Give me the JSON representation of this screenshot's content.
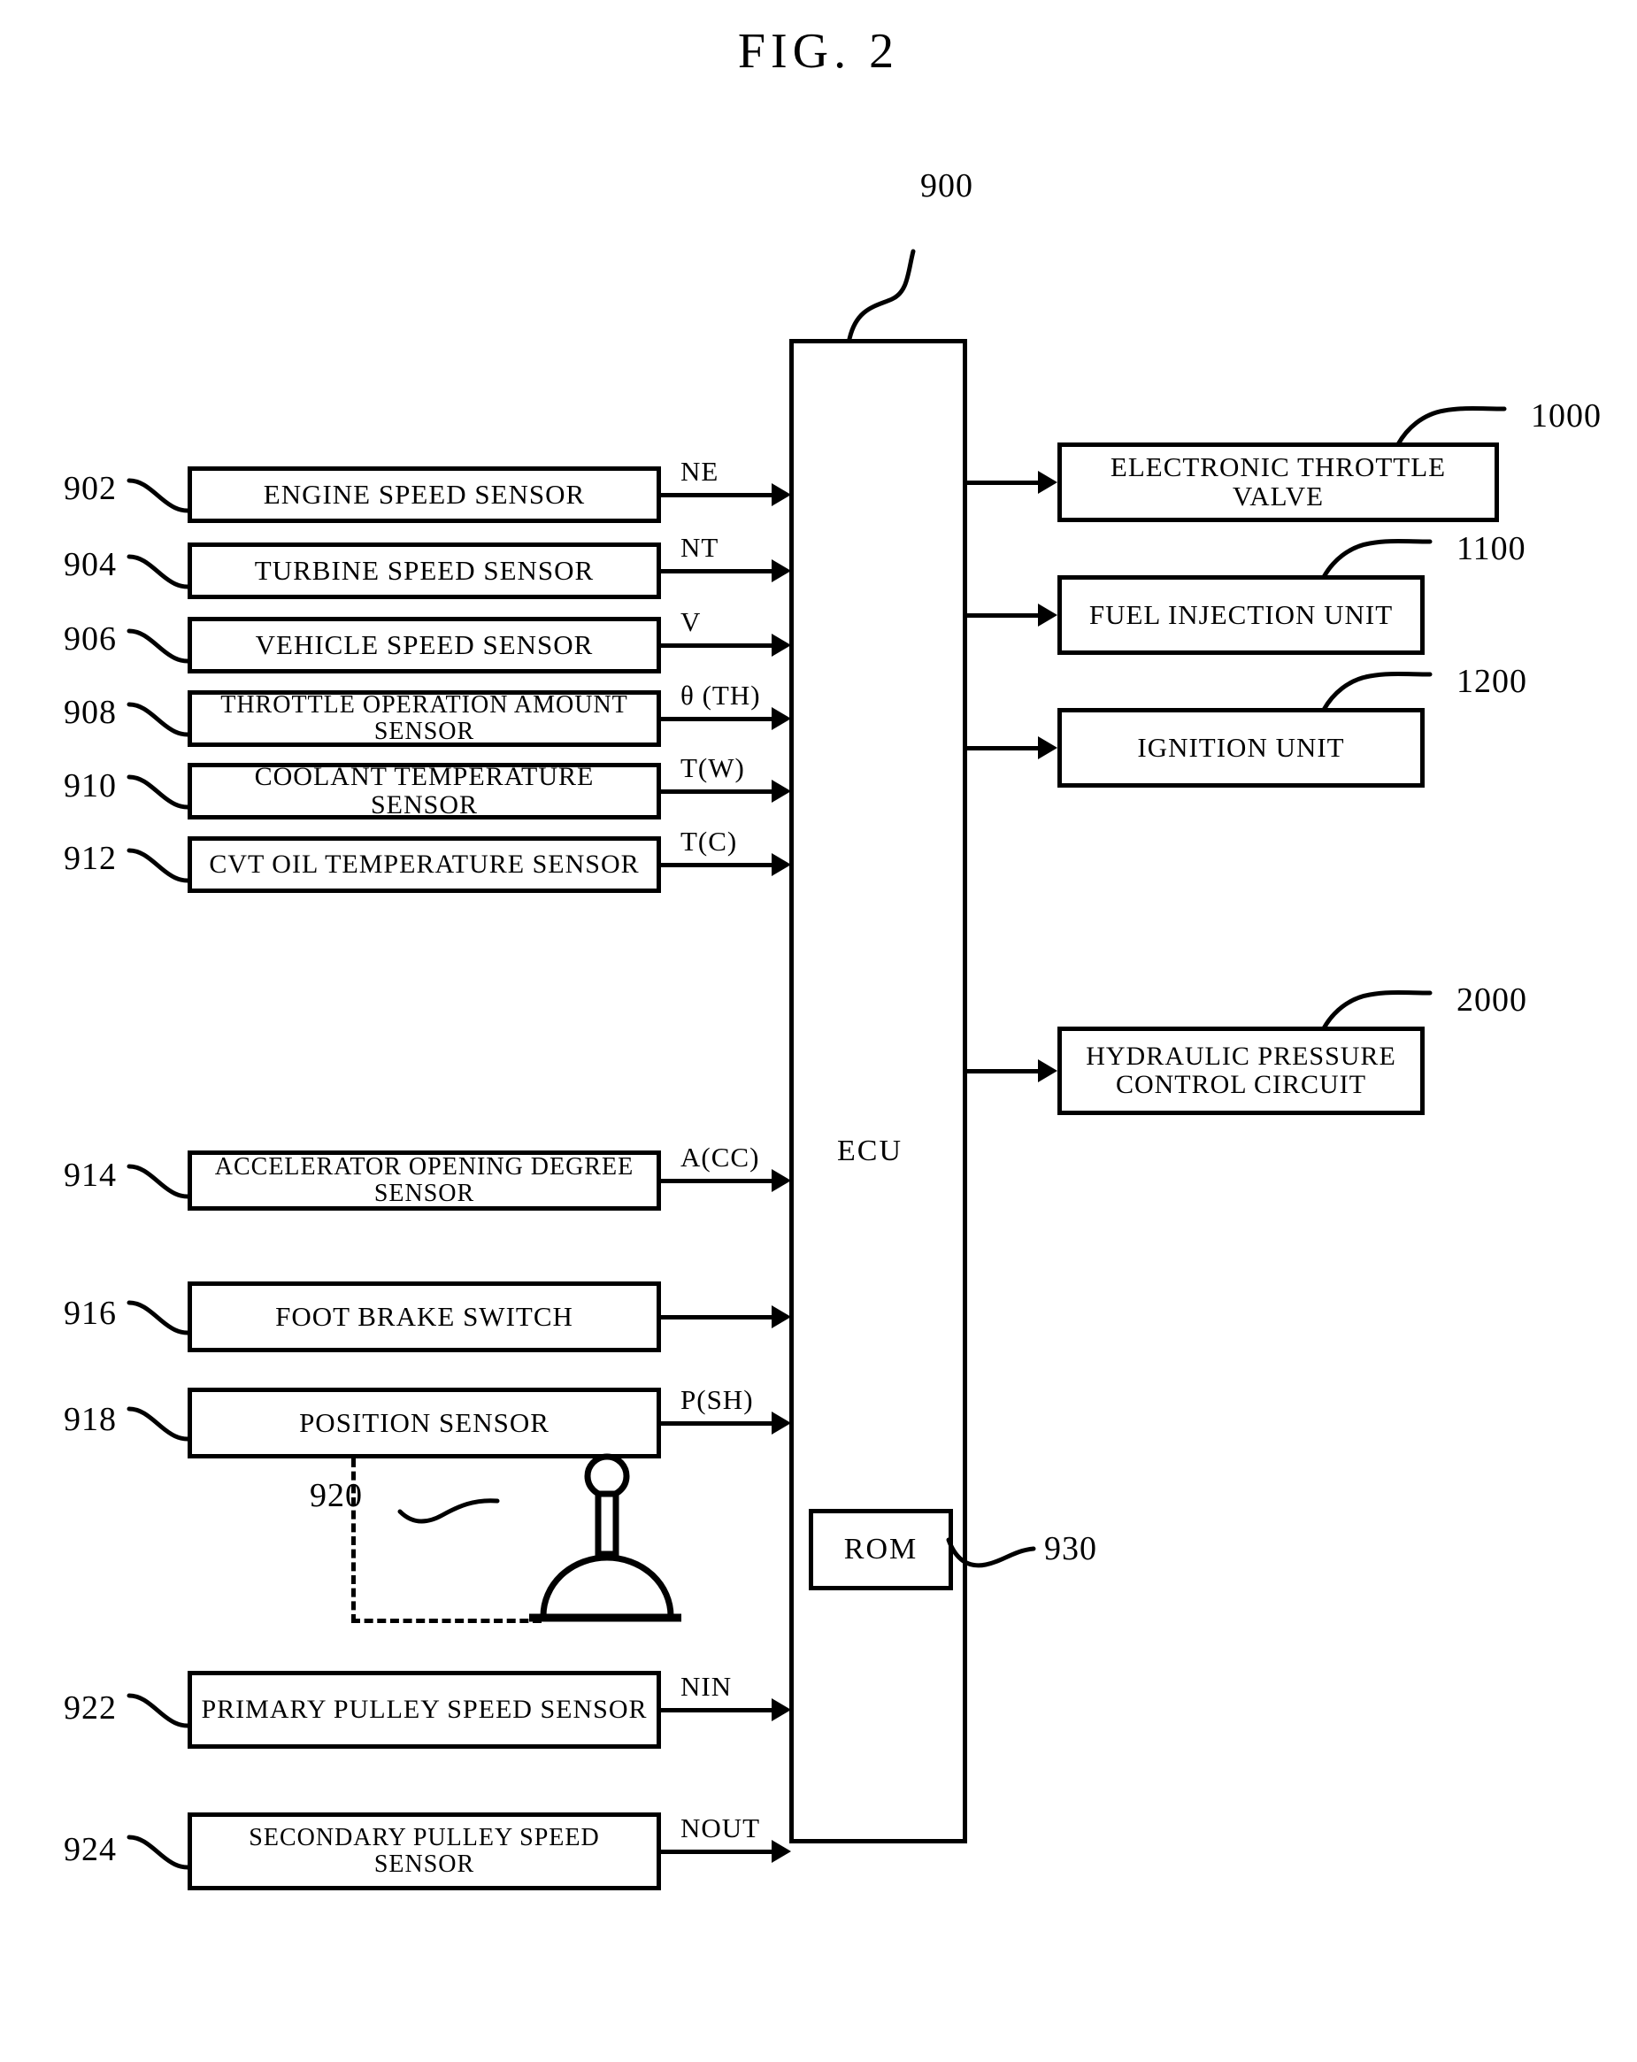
{
  "figure": {
    "title": "FIG. 2",
    "ecu_label": "ECU",
    "ecu_ref": "900",
    "rom_label": "ROM",
    "rom_ref": "930",
    "lever_ref": "920"
  },
  "inputs": [
    {
      "ref": "902",
      "label": "ENGINE SPEED SENSOR",
      "signal": "NE",
      "two_line": false
    },
    {
      "ref": "904",
      "label": "TURBINE SPEED SENSOR",
      "signal": "NT",
      "two_line": false
    },
    {
      "ref": "906",
      "label": "VEHICLE SPEED SENSOR",
      "signal": "V",
      "two_line": false
    },
    {
      "ref": "908",
      "label": "THROTTLE OPERATION AMOUNT SENSOR",
      "signal": "θ (TH)",
      "two_line": false
    },
    {
      "ref": "910",
      "label": "COOLANT TEMPERATURE SENSOR",
      "signal": "T(W)",
      "two_line": false
    },
    {
      "ref": "912",
      "label": "CVT OIL TEMPERATURE SENSOR",
      "signal": "T(C)",
      "two_line": false
    },
    {
      "ref": "914",
      "label": "ACCELERATOR OPENING DEGREE SENSOR",
      "signal": "A(CC)",
      "two_line": false
    },
    {
      "ref": "916",
      "label": "FOOT BRAKE SWITCH",
      "signal": "",
      "two_line": false
    },
    {
      "ref": "918",
      "label": "POSITION SENSOR",
      "signal": "P(SH)",
      "two_line": false
    },
    {
      "ref": "922",
      "label": "PRIMARY PULLEY SPEED SENSOR",
      "signal": "NIN",
      "two_line": false
    },
    {
      "ref": "924",
      "label": "SECONDARY PULLEY SPEED SENSOR",
      "signal": "NOUT",
      "two_line": false
    }
  ],
  "outputs": [
    {
      "ref": "1000",
      "label": "ELECTRONIC THROTTLE VALVE"
    },
    {
      "ref": "1100",
      "label": "FUEL INJECTION UNIT"
    },
    {
      "ref": "1200",
      "label": "IGNITION UNIT"
    },
    {
      "ref": "2000",
      "label": "HYDRAULIC PRESSURE CONTROL CIRCUIT",
      "line1": "HYDRAULIC PRESSURE",
      "line2": "CONTROL CIRCUIT"
    }
  ],
  "colors": {
    "ink": "#000000",
    "paper": "#ffffff"
  }
}
